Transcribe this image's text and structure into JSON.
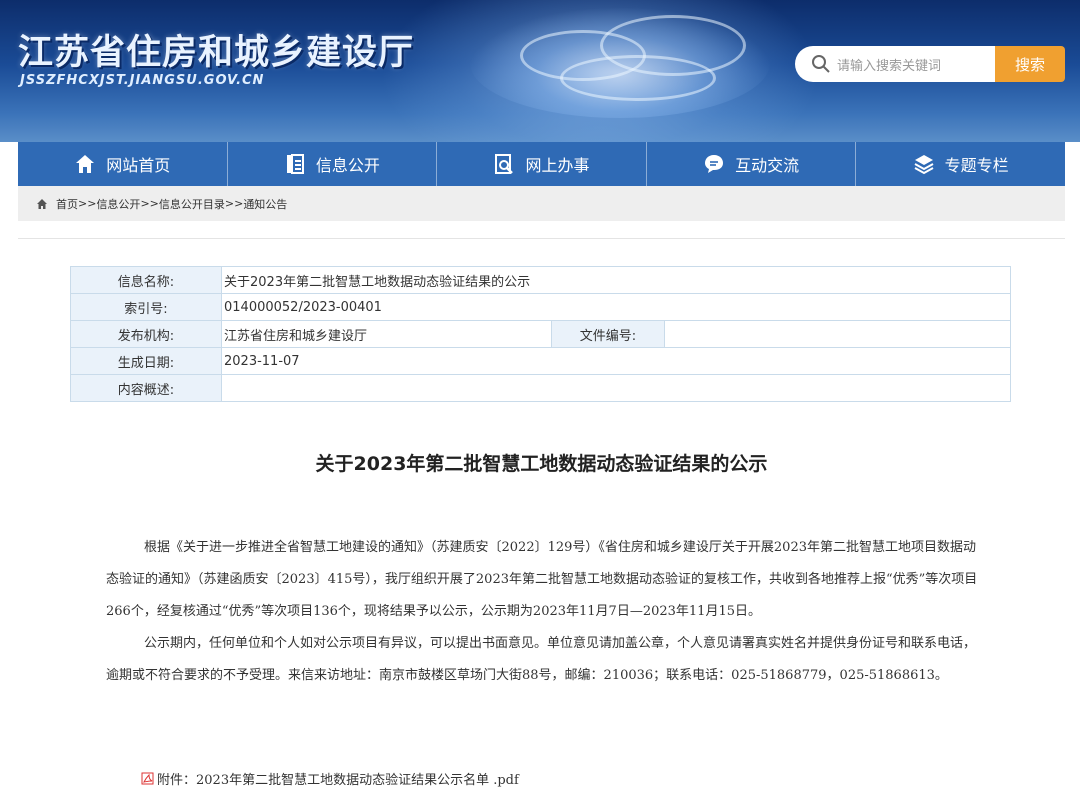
{
  "header": {
    "site_title": "江苏省住房和城乡建设厅",
    "site_url": "JSSZFHCXJST.JIANGSU.GOV.CN",
    "search_placeholder": "请输入搜索关键词",
    "search_button": "搜索"
  },
  "nav": {
    "items": [
      {
        "label": "网站首页",
        "icon": "home-icon"
      },
      {
        "label": "信息公开",
        "icon": "document-list-icon"
      },
      {
        "label": "网上办事",
        "icon": "search-document-icon"
      },
      {
        "label": "互动交流",
        "icon": "chat-bubble-icon"
      },
      {
        "label": "专题专栏",
        "icon": "layers-icon"
      }
    ]
  },
  "breadcrumb": {
    "home": "首页",
    "sep1": ">>",
    "item1": "信息公开",
    "sep2": ">>",
    "item2": "信息公开目录",
    "sep3": ">>",
    "item3": "通知公告"
  },
  "meta": {
    "name_label": "信息名称:",
    "name_value": "关于2023年第二批智慧工地数据动态验证结果的公示",
    "index_label": "索引号:",
    "index_value": "014000052/2023-00401",
    "org_label": "发布机构:",
    "org_value": "江苏省住房和城乡建设厅",
    "doc_no_label": "文件编号:",
    "doc_no_value": "",
    "date_label": "生成日期:",
    "date_value": "2023-11-07",
    "summary_label": "内容概述:",
    "summary_value": ""
  },
  "article": {
    "title": "关于2023年第二批智慧工地数据动态验证结果的公示",
    "para1": "根据《关于进一步推进全省智慧工地建设的通知》（苏建质安〔2022〕129号）《省住房和城乡建设厅关于开展2023年第二批智慧工地项目数据动态验证的通知》（苏建函质安〔2023〕415号），我厅组织开展了2023年第二批智慧工地数据动态验证的复核工作，共收到各地推荐上报“优秀”等次项目266个，经复核通过“优秀”等次项目136个，现将结果予以公示，公示期为2023年11月7日—2023年11月15日。",
    "para2": "公示期内，任何单位和个人如对公示项目有异议，可以提出书面意见。单位意见请加盖公章，个人意见请署真实姓名并提供身份证号和联系电话，逾期或不符合要求的不予受理。来信来访地址：南京市鼓楼区草场门大街88号，邮编：210036；联系电话：025-51868779，025-51868613。",
    "attachment": "附件：2023年第二批智慧工地数据动态验证结果公示名单 .pdf"
  },
  "colors": {
    "nav_bg": "#2f6ab5",
    "search_button": "#f0a030",
    "table_border": "#c9dbea",
    "label_bg": "#eaf2fa"
  }
}
